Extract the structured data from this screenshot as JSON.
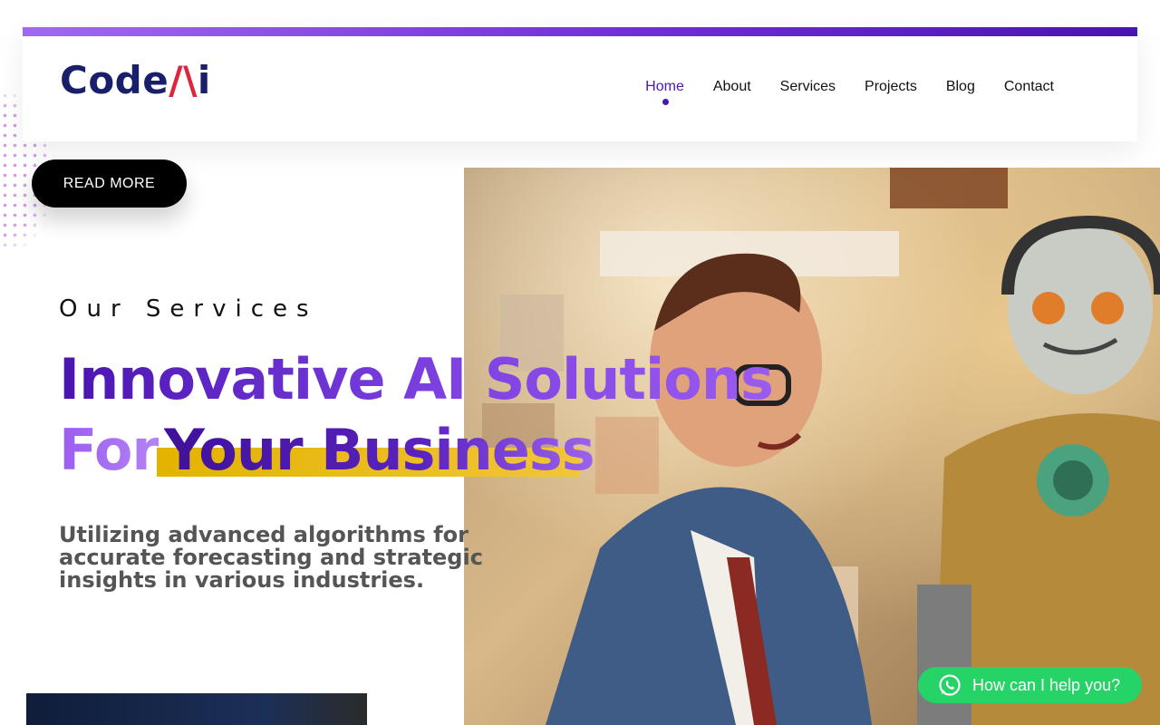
{
  "brand": {
    "logo_part1": "Code",
    "logo_part2": "/\\",
    "logo_part3": "i",
    "logo_colors": {
      "primary": "#1a1f6b",
      "accent": "#e0243c"
    }
  },
  "nav": {
    "items": [
      {
        "label": "Home",
        "active": true
      },
      {
        "label": "About",
        "active": false
      },
      {
        "label": "Services",
        "active": false
      },
      {
        "label": "Projects",
        "active": false
      },
      {
        "label": "Blog",
        "active": false
      },
      {
        "label": "Contact",
        "active": false
      }
    ]
  },
  "hero": {
    "read_more_label": "READ MORE",
    "eyebrow": "Our Services",
    "headline_line1": "Innovative AI Solutions",
    "headline_for": "For",
    "headline_business": "Your Business",
    "description": "Utilizing advanced algorithms for accurate forecasting and strategic insights in various industries."
  },
  "chat": {
    "label": "How can I help you?",
    "icon": "whatsapp-icon",
    "color": "#25d366"
  },
  "theme": {
    "accent_purple": "#4b18b0",
    "highlight_yellow": "#e4b200"
  }
}
